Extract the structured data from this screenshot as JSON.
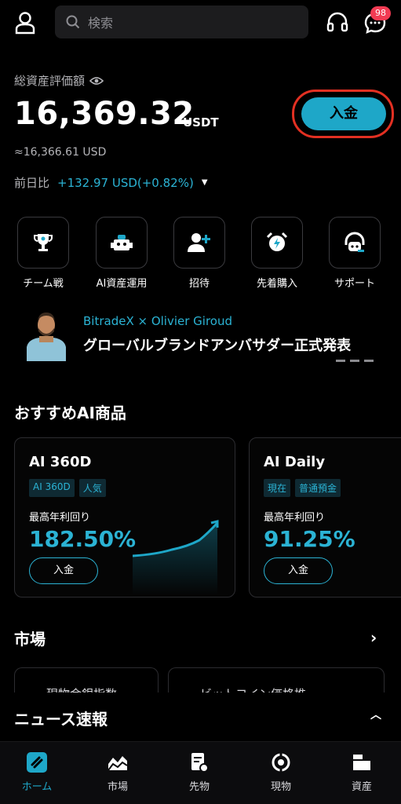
{
  "header": {
    "search_placeholder": "検索",
    "notification_count": "98"
  },
  "assets": {
    "label": "総資産評価額",
    "total": "16,369.32",
    "unit": "USDT",
    "usd_approx": "≈16,366.61 USD",
    "change_label": "前日比",
    "change_value": "+132.97 USD(+0.82%)",
    "deposit_label": "入金"
  },
  "quick_actions": [
    {
      "label": "チーム戦",
      "icon": "trophy-icon"
    },
    {
      "label": "AI資産運用",
      "icon": "robot-icon"
    },
    {
      "label": "招待",
      "icon": "invite-user-icon"
    },
    {
      "label": "先着購入",
      "icon": "alarm-clock-icon"
    },
    {
      "label": "サポート",
      "icon": "support-icon"
    }
  ],
  "banner": {
    "line1": "BitradeX × Olivier Giroud",
    "line2": "グローバルブランドアンバサダー正式発表"
  },
  "ai_products": {
    "title": "おすすめAI商品",
    "cards": [
      {
        "name": "AI 360D",
        "tags": [
          "AI 360D",
          "人気"
        ],
        "yield_label": "最高年利回り",
        "yield": "182.50%",
        "button": "入金"
      },
      {
        "name": "AI Daily",
        "tags": [
          "現在",
          "普通預金"
        ],
        "yield_label": "最高年利回り",
        "yield": "91.25%",
        "button": "入金"
      }
    ]
  },
  "market": {
    "title": "市場",
    "cards": [
      "現物金銀指数",
      "ビットコイン価格推"
    ]
  },
  "news": {
    "title": "ニュース速報"
  },
  "tabs": [
    {
      "label": "ホーム",
      "active": true
    },
    {
      "label": "市場"
    },
    {
      "label": "先物"
    },
    {
      "label": "現物"
    },
    {
      "label": "資産"
    }
  ],
  "colors": {
    "accent": "#1ea7c8",
    "highlight_ring": "#e33022",
    "badge": "#f23b53",
    "background": "#000000"
  }
}
